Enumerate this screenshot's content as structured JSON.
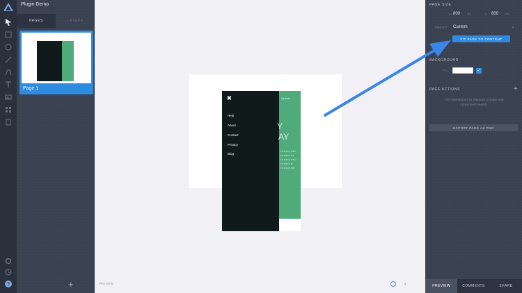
{
  "project": {
    "title": "Plugin Demo"
  },
  "left_tabs": [
    "PAGES",
    "LAYERS"
  ],
  "page": {
    "name": "Page 1"
  },
  "canvas": {
    "menu": [
      "Help",
      "About",
      "Contact",
      "Privacy",
      "Blog"
    ],
    "green_header": "Update",
    "big_letters": [
      "Y",
      "AY"
    ],
    "footer_label": "PREVIEW"
  },
  "inspector": {
    "page_size": {
      "title": "PAGE SIZE",
      "w_label": "W",
      "w_value": "800",
      "h_label": "H",
      "h_value": "600",
      "unit": "PX",
      "preset_label": "PRESET",
      "preset_value": "Custom",
      "fit_button": "FIT PAGE TO CONTENT"
    },
    "background": {
      "title": "BACKGROUND",
      "fill_label": "FILL"
    },
    "page_actions": {
      "title": "PAGE ACTIONS",
      "hint": "Add interactions to respond to page and component events"
    },
    "export_button": "EXPORT PAGE AS PNG",
    "bottom": [
      "PREVIEW",
      "COMMENTS",
      "SHARE"
    ]
  },
  "colors": {
    "accent": "#2f8be0",
    "green": "#4fac7a",
    "dark": "#0f1a1a"
  }
}
